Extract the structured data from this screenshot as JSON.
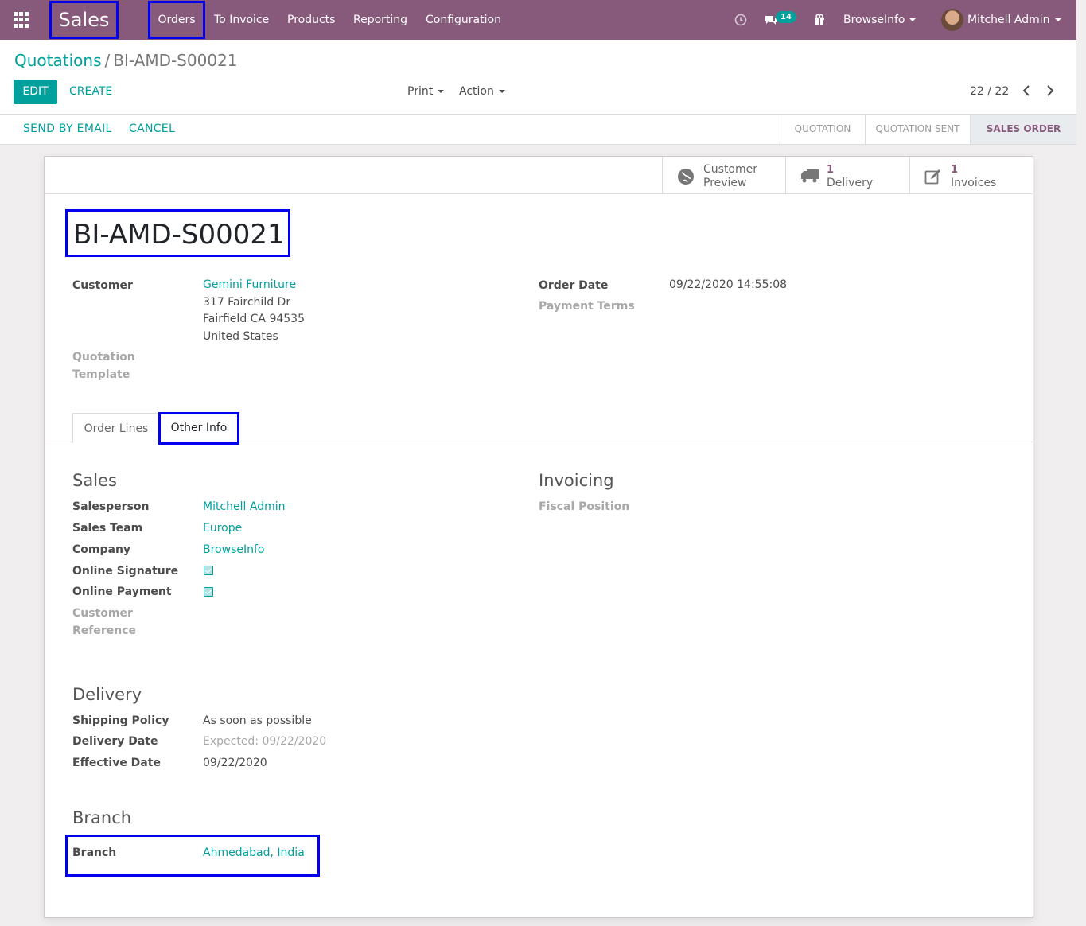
{
  "navbar": {
    "app_name": "Sales",
    "menu": [
      "Orders",
      "To Invoice",
      "Products",
      "Reporting",
      "Configuration"
    ],
    "messages_count": "14",
    "company": "BrowseInfo",
    "user": "Mitchell Admin",
    "icons": [
      "apps-icon",
      "clock-icon",
      "chat-icon",
      "gift-icon"
    ]
  },
  "control_panel": {
    "breadcrumb_parent": "Quotations",
    "breadcrumb_separator": "/",
    "breadcrumb_current": "BI-AMD-S00021",
    "edit_label": "EDIT",
    "create_label": "CREATE",
    "print_label": "Print",
    "action_label": "Action",
    "pager": "22 / 22"
  },
  "status_bar": {
    "send_by_email": "SEND BY EMAIL",
    "cancel": "CANCEL",
    "stages": [
      "QUOTATION",
      "QUOTATION SENT",
      "SALES ORDER"
    ],
    "active_stage": "SALES ORDER"
  },
  "smart_buttons": {
    "customer_preview_line1": "Customer",
    "customer_preview_line2": "Preview",
    "delivery_count": "1",
    "delivery_label": "Delivery",
    "invoices_count": "1",
    "invoices_label": "Invoices"
  },
  "record": {
    "name": "BI-AMD-S00021",
    "customer_label": "Customer",
    "customer_name": "Gemini Furniture",
    "customer_address": [
      "317 Fairchild Dr",
      "Fairfield CA 94535",
      "United States"
    ],
    "quotation_template_label_1": "Quotation",
    "quotation_template_label_2": "Template",
    "order_date_label": "Order Date",
    "order_date": "09/22/2020 14:55:08",
    "payment_terms_label": "Payment Terms"
  },
  "tabs": {
    "order_lines": "Order Lines",
    "other_info": "Other Info"
  },
  "sales": {
    "title": "Sales",
    "salesperson_label": "Salesperson",
    "salesperson": "Mitchell Admin",
    "sales_team_label": "Sales Team",
    "sales_team": "Europe",
    "company_label": "Company",
    "company": "BrowseInfo",
    "online_signature_label": "Online Signature",
    "online_signature": true,
    "online_payment_label": "Online Payment",
    "online_payment": true,
    "customer_reference_label_1": "Customer",
    "customer_reference_label_2": "Reference"
  },
  "invoicing": {
    "title": "Invoicing",
    "fiscal_position_label": "Fiscal Position"
  },
  "delivery": {
    "title": "Delivery",
    "shipping_policy_label": "Shipping Policy",
    "shipping_policy": "As soon as possible",
    "delivery_date_label": "Delivery Date",
    "delivery_date": "Expected: 09/22/2020",
    "effective_date_label": "Effective Date",
    "effective_date": "09/22/2020"
  },
  "branch": {
    "title": "Branch",
    "branch_label": "Branch",
    "branch_value": "Ahmedabad, India"
  },
  "colors": {
    "navbar": "#875a7b",
    "accent": "#00a09d",
    "highlight_border": "#0000ee"
  }
}
